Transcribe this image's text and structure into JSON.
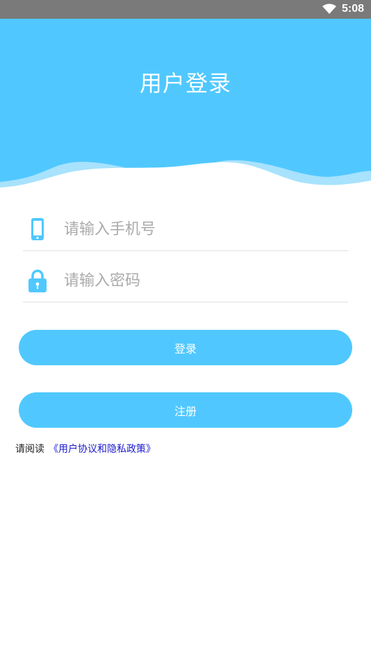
{
  "status_bar": {
    "time": "5:08",
    "wifi_icon": "wifi-icon"
  },
  "header": {
    "title": "用户登录",
    "background": "#50c8ff"
  },
  "form": {
    "phone": {
      "icon": "phone-icon",
      "placeholder": "请输入手机号",
      "value": ""
    },
    "password": {
      "icon": "lock-icon",
      "placeholder": "请输入密码",
      "value": ""
    }
  },
  "buttons": {
    "login_label": "登录",
    "register_label": "注册"
  },
  "agreement": {
    "prefix": "请阅读",
    "link_text": "《用户协议和隐私政策》"
  },
  "colors": {
    "accent": "#50c8ff",
    "link": "#1a1acc",
    "status_bar": "#7a7a7a"
  }
}
